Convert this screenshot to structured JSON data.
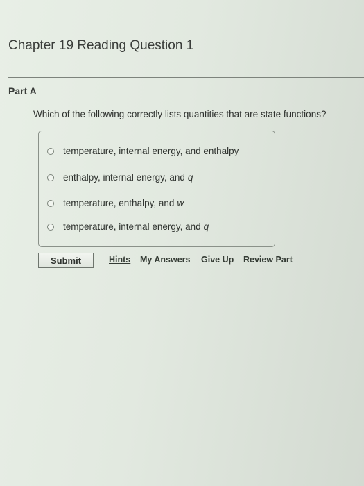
{
  "header": {
    "title": "Chapter 19 Reading Question 1"
  },
  "part": {
    "label": "Part A",
    "question": "Which of the following correctly lists quantities that are state functions?"
  },
  "options": [
    {
      "text": "temperature, internal energy, and enthalpy",
      "var": ""
    },
    {
      "text": "enthalpy, internal energy, and",
      "var": "q"
    },
    {
      "text": "temperature, enthalpy, and",
      "var": "w"
    },
    {
      "text": "temperature, internal energy, and",
      "var": "q"
    }
  ],
  "actions": {
    "submit": "Submit",
    "hints": "Hints",
    "my_answers": "My Answers",
    "give_up": "Give Up",
    "review_part": "Review Part"
  }
}
